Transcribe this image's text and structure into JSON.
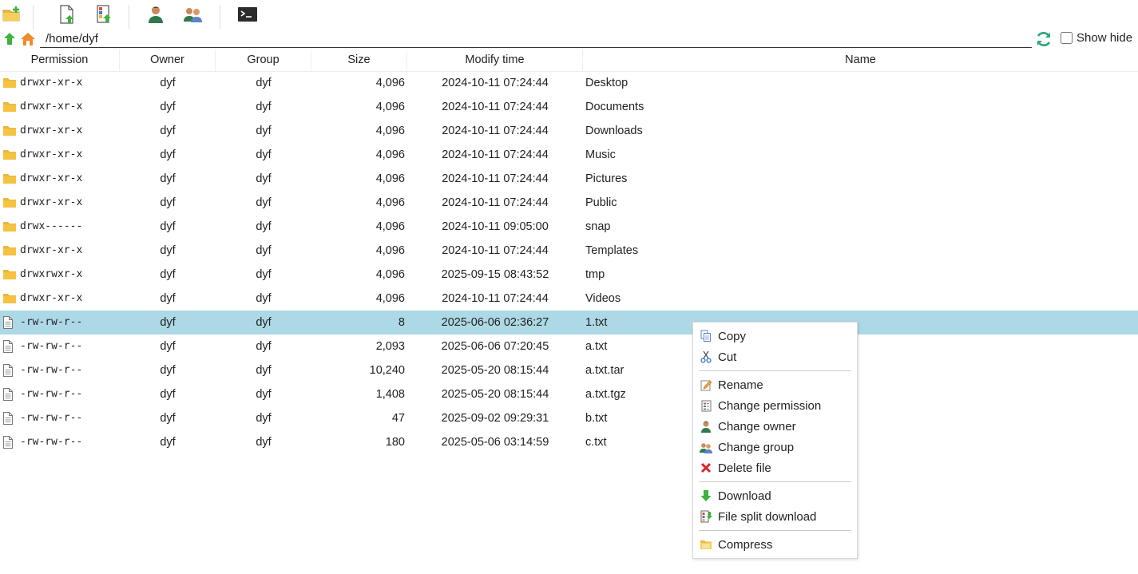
{
  "toolbar": {
    "buttons": [
      {
        "name": "new-folder-icon"
      },
      {
        "name": "upload-file-icon"
      },
      {
        "name": "upload-split-file-icon"
      },
      {
        "name": "user-icon"
      },
      {
        "name": "group-icon"
      },
      {
        "name": "terminal-icon"
      }
    ]
  },
  "pathbar": {
    "path": "/home/dyf",
    "show_hide_label": "Show hide",
    "show_hide_checked": false
  },
  "table": {
    "headers": {
      "permission": "Permission",
      "owner": "Owner",
      "group": "Group",
      "size": "Size",
      "modify_time": "Modify time",
      "name": "Name"
    },
    "rows": [
      {
        "type": "folder",
        "permission": "drwxr-xr-x",
        "owner": "dyf",
        "group": "dyf",
        "size": "4,096",
        "time": "2024-10-11 07:24:44",
        "name": "Desktop"
      },
      {
        "type": "folder",
        "permission": "drwxr-xr-x",
        "owner": "dyf",
        "group": "dyf",
        "size": "4,096",
        "time": "2024-10-11 07:24:44",
        "name": "Documents"
      },
      {
        "type": "folder",
        "permission": "drwxr-xr-x",
        "owner": "dyf",
        "group": "dyf",
        "size": "4,096",
        "time": "2024-10-11 07:24:44",
        "name": "Downloads"
      },
      {
        "type": "folder",
        "permission": "drwxr-xr-x",
        "owner": "dyf",
        "group": "dyf",
        "size": "4,096",
        "time": "2024-10-11 07:24:44",
        "name": "Music"
      },
      {
        "type": "folder",
        "permission": "drwxr-xr-x",
        "owner": "dyf",
        "group": "dyf",
        "size": "4,096",
        "time": "2024-10-11 07:24:44",
        "name": "Pictures"
      },
      {
        "type": "folder",
        "permission": "drwxr-xr-x",
        "owner": "dyf",
        "group": "dyf",
        "size": "4,096",
        "time": "2024-10-11 07:24:44",
        "name": "Public"
      },
      {
        "type": "folder",
        "permission": "drwx------",
        "owner": "dyf",
        "group": "dyf",
        "size": "4,096",
        "time": "2024-10-11 09:05:00",
        "name": "snap"
      },
      {
        "type": "folder",
        "permission": "drwxr-xr-x",
        "owner": "dyf",
        "group": "dyf",
        "size": "4,096",
        "time": "2024-10-11 07:24:44",
        "name": "Templates"
      },
      {
        "type": "folder",
        "permission": "drwxrwxr-x",
        "owner": "dyf",
        "group": "dyf",
        "size": "4,096",
        "time": "2025-09-15 08:43:52",
        "name": "tmp"
      },
      {
        "type": "folder",
        "permission": "drwxr-xr-x",
        "owner": "dyf",
        "group": "dyf",
        "size": "4,096",
        "time": "2024-10-11 07:24:44",
        "name": "Videos"
      },
      {
        "type": "file",
        "permission": "-rw-rw-r--",
        "owner": "dyf",
        "group": "dyf",
        "size": "8",
        "time": "2025-06-06 02:36:27",
        "name": "1.txt",
        "selected": true
      },
      {
        "type": "file",
        "permission": "-rw-rw-r--",
        "owner": "dyf",
        "group": "dyf",
        "size": "2,093",
        "time": "2025-06-06 07:20:45",
        "name": "a.txt"
      },
      {
        "type": "file",
        "permission": "-rw-rw-r--",
        "owner": "dyf",
        "group": "dyf",
        "size": "10,240",
        "time": "2025-05-20 08:15:44",
        "name": "a.txt.tar"
      },
      {
        "type": "file",
        "permission": "-rw-rw-r--",
        "owner": "dyf",
        "group": "dyf",
        "size": "1,408",
        "time": "2025-05-20 08:15:44",
        "name": "a.txt.tgz"
      },
      {
        "type": "file",
        "permission": "-rw-rw-r--",
        "owner": "dyf",
        "group": "dyf",
        "size": "47",
        "time": "2025-09-02 09:29:31",
        "name": "b.txt"
      },
      {
        "type": "file",
        "permission": "-rw-rw-r--",
        "owner": "dyf",
        "group": "dyf",
        "size": "180",
        "time": "2025-05-06 03:14:59",
        "name": "c.txt"
      }
    ]
  },
  "context_menu": {
    "items": [
      {
        "label": "Copy",
        "icon": "copy-icon"
      },
      {
        "label": "Cut",
        "icon": "cut-icon"
      },
      {
        "separator": true
      },
      {
        "label": "Rename",
        "icon": "rename-icon"
      },
      {
        "label": "Change permission",
        "icon": "permission-icon"
      },
      {
        "label": "Change owner",
        "icon": "user-icon"
      },
      {
        "label": "Change group",
        "icon": "group-icon"
      },
      {
        "label": "Delete file",
        "icon": "delete-icon"
      },
      {
        "separator": true
      },
      {
        "label": "Download",
        "icon": "download-icon"
      },
      {
        "label": "File split download",
        "icon": "split-download-icon"
      },
      {
        "separator": true
      },
      {
        "label": "Compress",
        "icon": "compress-icon"
      }
    ]
  },
  "colors": {
    "selected_row": "#add8e6",
    "folder": "#f5c242",
    "accent_green": "#3cb33c",
    "refresh": "#2aa876",
    "delete_red": "#d9262b"
  }
}
